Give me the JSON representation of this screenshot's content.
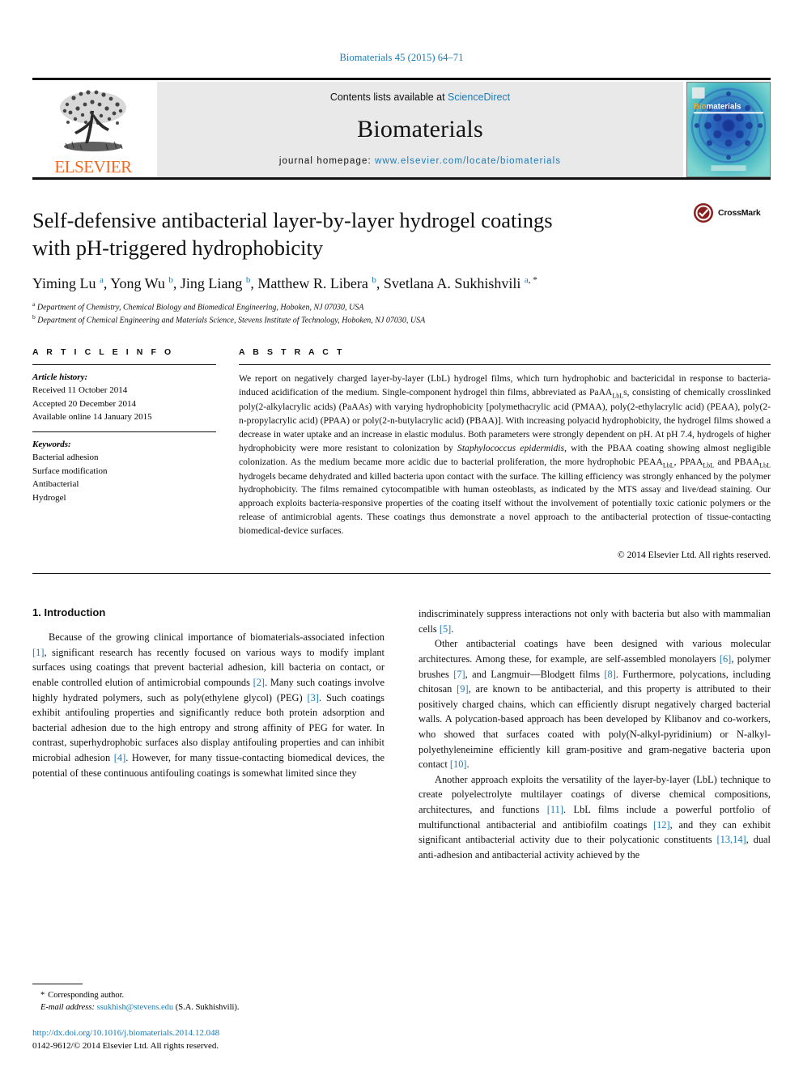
{
  "running_head": "Biomaterials 45 (2015) 64–71",
  "masthead": {
    "contents_prefix": "Contents lists available at ",
    "sciencedirect": "ScienceDirect",
    "journal_name": "Biomaterials",
    "homepage_prefix": "journal homepage: ",
    "homepage_url": "www.elsevier.com/locate/biomaterials",
    "publisher": "ELSEVIER",
    "cover_title_bio": "Bio",
    "cover_title_rest": "materials",
    "accent_blue": "#1a7bb9",
    "elsevier_orange": "#f26a21"
  },
  "article": {
    "title_line1": "Self-defensive antibacterial layer-by-layer hydrogel coatings",
    "title_line2": "with pH-triggered hydrophobicity",
    "crossmark_label": "CrossMark",
    "authors": [
      {
        "name": "Yiming Lu",
        "sup": "a",
        "sep": ", "
      },
      {
        "name": "Yong Wu",
        "sup": "b",
        "sep": ", "
      },
      {
        "name": "Jing Liang",
        "sup": "b",
        "sep": ", "
      },
      {
        "name": "Matthew R. Libera",
        "sup": "b",
        "sep": ", "
      },
      {
        "name": "Svetlana A. Sukhishvili",
        "sup": "a",
        "sep": ""
      }
    ],
    "corresponding_star": "*",
    "affiliations": [
      {
        "mark": "a",
        "text": "Department of Chemistry, Chemical Biology and Biomedical Engineering, Hoboken, NJ 07030, USA"
      },
      {
        "mark": "b",
        "text": "Department of Chemical Engineering and Materials Science, Stevens Institute of Technology, Hoboken, NJ 07030, USA"
      }
    ]
  },
  "article_info": {
    "heading": "A R T I C L E   I N F O",
    "history_label": "Article history:",
    "history": [
      "Received 11 October 2014",
      "Accepted 20 December 2014",
      "Available online 14 January 2015"
    ],
    "keywords_label": "Keywords:",
    "keywords": [
      "Bacterial adhesion",
      "Surface modification",
      "Antibacterial",
      "Hydrogel"
    ]
  },
  "abstract": {
    "heading": "A B S T R A C T",
    "part1": "We report on negatively charged layer-by-layer (LbL) hydrogel films, which turn hydrophobic and bactericidal in response to bacteria-induced acidification of the medium. Single-component hydrogel thin films, abbreviated as PaAA",
    "sub1": "LbL",
    "part2": "s, consisting of chemically crosslinked poly(2-alkylacrylic acids) (PaAAs) with varying hydrophobicity [polymethacrylic acid (PMAA), poly(2-ethylacrylic acid) (PEAA), poly(2-n-propylacrylic acid) (PPAA) or poly(2-n-butylacrylic acid) (PBAA)]. With increasing polyacid hydrophobicity, the hydrogel films showed a decrease in water uptake and an increase in elastic modulus. Both parameters were strongly dependent on pH. At pH 7.4, hydrogels of higher hydrophobicity were more resistant to colonization by ",
    "italic1": "Staphylococcus epidermidis",
    "part3": ", with the PBAA coating showing almost negligible colonization. As the medium became more acidic due to bacterial proliferation, the more hydrophobic PEAA",
    "sub2": "LbL",
    "part4": ", PPAA",
    "sub3": "LbL",
    "part5": " and PBAA",
    "sub4": "LbL",
    "part6": " hydrogels became dehydrated and killed bacteria upon contact with the surface. The killing efficiency was strongly enhanced by the polymer hydrophobicity. The films remained cytocompatible with human osteoblasts, as indicated by the MTS assay and live/dead staining. Our approach exploits bacteria-responsive properties of the coating itself without the involvement of potentially toxic cationic polymers or the release of antimicrobial agents. These coatings thus demonstrate a novel approach to the antibacterial protection of tissue-contacting biomedical-device surfaces.",
    "copyright": "© 2014 Elsevier Ltd. All rights reserved."
  },
  "body": {
    "section_heading": "1. Introduction",
    "left_paragraphs": [
      {
        "segments": [
          {
            "t": "Because of the growing clinical importance of biomaterials-associated infection "
          },
          {
            "t": "[1]",
            "ref": true
          },
          {
            "t": ", significant research has recently focused on various ways to modify implant surfaces using coatings that prevent bacterial adhesion, kill bacteria on contact, or enable controlled elution of antimicrobial compounds "
          },
          {
            "t": "[2]",
            "ref": true
          },
          {
            "t": ". Many such coatings involve highly hydrated polymers, such as poly(ethylene glycol) (PEG) "
          },
          {
            "t": "[3]",
            "ref": true
          },
          {
            "t": ". Such coatings exhibit antifouling properties and significantly reduce both protein adsorption and bacterial adhesion due to the high entropy and strong affinity of PEG for water. In contrast, superhydrophobic surfaces also display antifouling properties and can inhibit microbial adhesion "
          },
          {
            "t": "[4]",
            "ref": true
          },
          {
            "t": ". However, for many tissue-contacting biomedical devices, the potential of these continuous antifouling coatings is somewhat limited since they"
          }
        ]
      }
    ],
    "right_paragraphs": [
      {
        "noindent": true,
        "segments": [
          {
            "t": "indiscriminately suppress interactions not only with bacteria but also with mammalian cells "
          },
          {
            "t": "[5]",
            "ref": true
          },
          {
            "t": "."
          }
        ]
      },
      {
        "segments": [
          {
            "t": "Other antibacterial coatings have been designed with various molecular architectures. Among these, for example, are self-assembled monolayers "
          },
          {
            "t": "[6]",
            "ref": true
          },
          {
            "t": ", polymer brushes "
          },
          {
            "t": "[7]",
            "ref": true
          },
          {
            "t": ", and Langmuir—Blodgett films "
          },
          {
            "t": "[8]",
            "ref": true
          },
          {
            "t": ". Furthermore, polycations, including chitosan "
          },
          {
            "t": "[9]",
            "ref": true
          },
          {
            "t": ", are known to be antibacterial, and this property is attributed to their positively charged chains, which can efficiently disrupt negatively charged bacterial walls. A polycation-based approach has been developed by Klibanov and co-workers, who showed that surfaces coated with poly(N-alkyl-pyridinium) or N-alkyl-polyethyleneimine efficiently kill gram-positive and gram-negative bacteria upon contact "
          },
          {
            "t": "[10]",
            "ref": true
          },
          {
            "t": "."
          }
        ]
      },
      {
        "segments": [
          {
            "t": "Another approach exploits the versatility of the layer-by-layer (LbL) technique to create polyelectrolyte multilayer coatings of diverse chemical compositions, architectures, and functions "
          },
          {
            "t": "[11]",
            "ref": true
          },
          {
            "t": ". LbL films include a powerful portfolio of multifunctional antibacterial and antibiofilm coatings "
          },
          {
            "t": "[12]",
            "ref": true
          },
          {
            "t": ", and they can exhibit significant antibacterial activity due to their polycationic constituents "
          },
          {
            "t": "[13,14]",
            "ref": true
          },
          {
            "t": ", dual anti-adhesion and antibacterial activity achieved by the"
          }
        ]
      }
    ]
  },
  "footer": {
    "corresponding_star": "*",
    "corresponding_label": "Corresponding author.",
    "email_label": "E-mail address:",
    "email": "ssukhish@stevens.edu",
    "email_suffix": "(S.A. Sukhishvili).",
    "doi": "http://dx.doi.org/10.1016/j.biomaterials.2014.12.048",
    "issn_line": "0142-9612/© 2014 Elsevier Ltd. All rights reserved."
  }
}
